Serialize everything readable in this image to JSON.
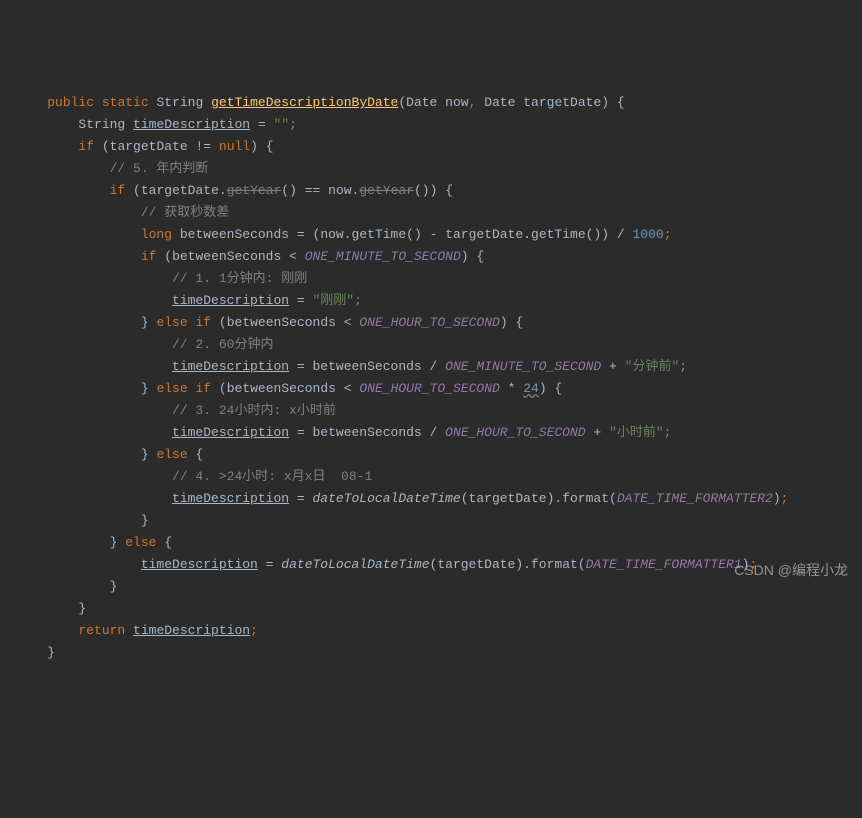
{
  "code": {
    "l1_public": "public",
    "l1_static": "static",
    "l1_type": "String",
    "l1_method": "getTimeDescriptionByDate",
    "l1_p1type": "Date",
    "l1_p1name": "now",
    "l1_p2type": "Date",
    "l1_p2name": "targetDate",
    "l2_type": "String",
    "l2_var": "timeDescription",
    "l2_val": "\"\"",
    "l3_if": "if",
    "l3_var": "targetDate",
    "l3_op": "!=",
    "l3_null": "null",
    "l4_comment": "// 5. 年内判断",
    "l5_if": "if",
    "l5_var": "targetDate",
    "l5_m1": "getYear",
    "l5_eq": "==",
    "l5_now": "now",
    "l5_m2": "getYear",
    "l6_comment": "// 获取秒数差",
    "l7_long": "long",
    "l7_var": "betweenSeconds",
    "l7_now": "now",
    "l7_m1": "getTime",
    "l7_target": "targetDate",
    "l7_m2": "getTime",
    "l7_num": "1000",
    "l8_if": "if",
    "l8_var": "betweenSeconds",
    "l8_const": "ONE_MINUTE_TO_SECOND",
    "l9_comment": "// 1. 1分钟内: 刚刚",
    "l10_var": "timeDescription",
    "l10_str": "\"刚刚\"",
    "l11_else": "else",
    "l11_if": "if",
    "l11_var": "betweenSeconds",
    "l11_const": "ONE_HOUR_TO_SECOND",
    "l12_comment": "// 2. 60分钟内",
    "l13_var": "timeDescription",
    "l13_var2": "betweenSeconds",
    "l13_const": "ONE_MINUTE_TO_SECOND",
    "l13_str": "\"分钟前\"",
    "l14_else": "else",
    "l14_if": "if",
    "l14_var": "betweenSeconds",
    "l14_const": "ONE_HOUR_TO_SECOND",
    "l14_num": "24",
    "l15_comment": "// 3. 24小时内: x小时前",
    "l16_var": "timeDescription",
    "l16_var2": "betweenSeconds",
    "l16_const": "ONE_HOUR_TO_SECOND",
    "l16_str": "\"小时前\"",
    "l17_else": "else",
    "l18_comment": "// 4. >24小时: x月x日  08-1",
    "l19_var": "timeDescription",
    "l19_m": "dateToLocalDateTime",
    "l19_arg": "targetDate",
    "l19_fmt": "format",
    "l19_const": "DATE_TIME_FORMATTER2",
    "l21_else": "else",
    "l22_var": "timeDescription",
    "l22_m": "dateToLocalDateTime",
    "l22_arg": "targetDate",
    "l22_fmt": "format",
    "l22_const": "DATE_TIME_FORMATTER1",
    "l25_return": "return",
    "l25_var": "timeDescription"
  },
  "watermark": "CSDN @编程小龙"
}
